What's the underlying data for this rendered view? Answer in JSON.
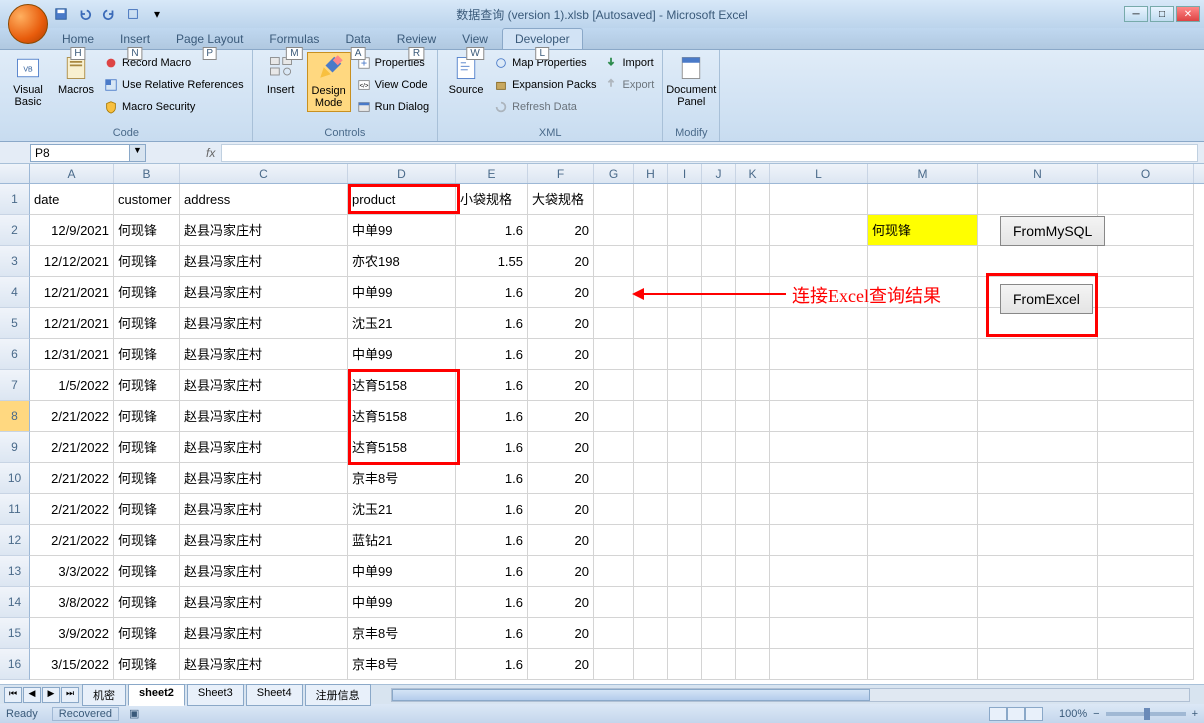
{
  "title": "数据查询 (version 1).xlsb [Autosaved] - Microsoft Excel",
  "tabs": [
    "Home",
    "Insert",
    "Page Layout",
    "Formulas",
    "Data",
    "Review",
    "View",
    "Developer"
  ],
  "tab_keys": [
    "H",
    "N",
    "P",
    "M",
    "A",
    "R",
    "W",
    "L"
  ],
  "active_tab": 7,
  "ribbon": {
    "code": {
      "label": "Code",
      "visual_basic": "Visual Basic",
      "macros": "Macros",
      "record_macro": "Record Macro",
      "use_rel": "Use Relative References",
      "macro_sec": "Macro Security"
    },
    "controls": {
      "label": "Controls",
      "insert": "Insert",
      "design": "Design Mode",
      "properties": "Properties",
      "view_code": "View Code",
      "run_dialog": "Run Dialog"
    },
    "xml": {
      "label": "XML",
      "source": "Source",
      "map_props": "Map Properties",
      "expansion": "Expansion Packs",
      "refresh": "Refresh Data",
      "import": "Import",
      "export": "Export"
    },
    "modify": {
      "label": "Modify",
      "doc_panel": "Document Panel"
    }
  },
  "name_box": "P8",
  "columns": [
    "A",
    "B",
    "C",
    "D",
    "E",
    "F",
    "G",
    "H",
    "I",
    "J",
    "K",
    "L",
    "M",
    "N",
    "O"
  ],
  "headers": {
    "A": "date",
    "B": "customer",
    "C": "address",
    "D": "product",
    "E": "小袋规格",
    "F": "大袋规格"
  },
  "rows": [
    {
      "n": 1
    },
    {
      "n": 2,
      "A": "12/9/2021",
      "B": "何现锋",
      "C": "赵县冯家庄村",
      "D": "中单99",
      "E": "1.6",
      "F": "20"
    },
    {
      "n": 3,
      "A": "12/12/2021",
      "B": "何现锋",
      "C": "赵县冯家庄村",
      "D": "亦农198",
      "E": "1.55",
      "F": "20"
    },
    {
      "n": 4,
      "A": "12/21/2021",
      "B": "何现锋",
      "C": "赵县冯家庄村",
      "D": "中单99",
      "E": "1.6",
      "F": "20"
    },
    {
      "n": 5,
      "A": "12/21/2021",
      "B": "何现锋",
      "C": "赵县冯家庄村",
      "D": "沈玉21",
      "E": "1.6",
      "F": "20"
    },
    {
      "n": 6,
      "A": "12/31/2021",
      "B": "何现锋",
      "C": "赵县冯家庄村",
      "D": "中单99",
      "E": "1.6",
      "F": "20"
    },
    {
      "n": 7,
      "A": "1/5/2022",
      "B": "何现锋",
      "C": "赵县冯家庄村",
      "D": "达育5158",
      "E": "1.6",
      "F": "20"
    },
    {
      "n": 8,
      "A": "2/21/2022",
      "B": "何现锋",
      "C": "赵县冯家庄村",
      "D": "达育5158",
      "E": "1.6",
      "F": "20"
    },
    {
      "n": 9,
      "A": "2/21/2022",
      "B": "何现锋",
      "C": "赵县冯家庄村",
      "D": "达育5158",
      "E": "1.6",
      "F": "20"
    },
    {
      "n": 10,
      "A": "2/21/2022",
      "B": "何现锋",
      "C": "赵县冯家庄村",
      "D": "京丰8号",
      "E": "1.6",
      "F": "20"
    },
    {
      "n": 11,
      "A": "2/21/2022",
      "B": "何现锋",
      "C": "赵县冯家庄村",
      "D": "沈玉21",
      "E": "1.6",
      "F": "20"
    },
    {
      "n": 12,
      "A": "2/21/2022",
      "B": "何现锋",
      "C": "赵县冯家庄村",
      "D": "蓝钻21",
      "E": "1.6",
      "F": "20"
    },
    {
      "n": 13,
      "A": "3/3/2022",
      "B": "何现锋",
      "C": "赵县冯家庄村",
      "D": "中单99",
      "E": "1.6",
      "F": "20"
    },
    {
      "n": 14,
      "A": "3/8/2022",
      "B": "何现锋",
      "C": "赵县冯家庄村",
      "D": "中单99",
      "E": "1.6",
      "F": "20"
    },
    {
      "n": 15,
      "A": "3/9/2022",
      "B": "何现锋",
      "C": "赵县冯家庄村",
      "D": "京丰8号",
      "E": "1.6",
      "F": "20"
    },
    {
      "n": 16,
      "A": "3/15/2022",
      "B": "何现锋",
      "C": "赵县冯家庄村",
      "D": "京丰8号",
      "E": "1.6",
      "F": "20"
    }
  ],
  "m2_value": "何现锋",
  "buttons": {
    "mysql": "FromMySQL",
    "excel": "FromExcel"
  },
  "annotation": "连接Excel查询结果",
  "sheets": [
    "机密",
    "sheet2",
    "Sheet3",
    "Sheet4",
    "注册信息"
  ],
  "active_sheet": 1,
  "status": {
    "ready": "Ready",
    "recovered": "Recovered",
    "zoom": "100%"
  }
}
